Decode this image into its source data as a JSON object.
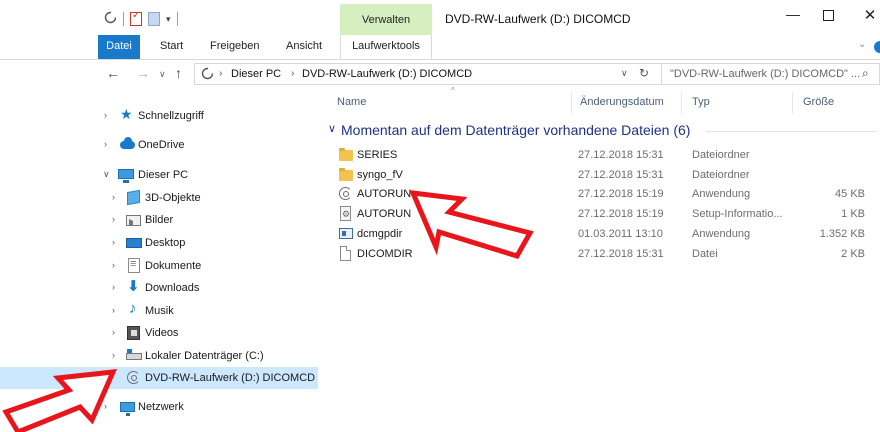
{
  "window": {
    "title": "DVD-RW-Laufwerk (D:) DICOMCD",
    "context_tab": "Verwalten",
    "controls": {
      "minimize": "—",
      "close": "✕"
    }
  },
  "ribbon": {
    "tabs": [
      "Datei",
      "Start",
      "Freigeben",
      "Ansicht",
      "Laufwerktools"
    ],
    "expand_glyph": "⌄"
  },
  "address": {
    "crumbs": [
      "Dieser PC",
      "DVD-RW-Laufwerk (D:) DICOMCD"
    ],
    "search_placeholder": "\"DVD-RW-Laufwerk (D:) DICOMCD\" ..."
  },
  "navigation": {
    "items": [
      {
        "label": "Schnellzugriff",
        "icon": "star-icon"
      },
      {
        "label": "OneDrive",
        "icon": "cloud-icon"
      },
      {
        "label": "Dieser PC",
        "icon": "computer-icon"
      },
      {
        "label": "3D-Objekte",
        "icon": "cube-icon"
      },
      {
        "label": "Bilder",
        "icon": "pictures-icon"
      },
      {
        "label": "Desktop",
        "icon": "desktop-icon"
      },
      {
        "label": "Dokumente",
        "icon": "documents-icon"
      },
      {
        "label": "Downloads",
        "icon": "download-icon"
      },
      {
        "label": "Musik",
        "icon": "music-icon"
      },
      {
        "label": "Videos",
        "icon": "video-icon"
      },
      {
        "label": "Lokaler Datenträger (C:)",
        "icon": "hard-drive-icon"
      },
      {
        "label": "DVD-RW-Laufwerk (D:) DICOMCD",
        "icon": "dvd-drive-icon",
        "selected": true
      },
      {
        "label": "Netzwerk",
        "icon": "network-icon"
      }
    ]
  },
  "columns": {
    "name": "Name",
    "date": "Änderungsdatum",
    "type": "Typ",
    "size": "Größe"
  },
  "group": {
    "label": "Momentan auf dem Datenträger vorhandene Dateien (6)"
  },
  "files": [
    {
      "name": "SERIES",
      "date": "27.12.2018 15:31",
      "type": "Dateiordner",
      "size": "",
      "icon": "folder-icon"
    },
    {
      "name": "syngo_fV",
      "date": "27.12.2018 15:31",
      "type": "Dateiordner",
      "size": "",
      "icon": "folder-icon"
    },
    {
      "name": "AUTORUN",
      "date": "27.12.2018 15:19",
      "type": "Anwendung",
      "size": "45 KB",
      "icon": "autorun-disc-icon"
    },
    {
      "name": "AUTORUN",
      "date": "27.12.2018 15:19",
      "type": "Setup-Informatio...",
      "size": "1 KB",
      "icon": "setup-file-icon"
    },
    {
      "name": "dcmgpdir",
      "date": "01.03.2011 13:10",
      "type": "Anwendung",
      "size": "1.352 KB",
      "icon": "application-icon"
    },
    {
      "name": "DICOMDIR",
      "date": "27.12.2018 15:31",
      "type": "Datei",
      "size": "2 KB",
      "icon": "file-icon"
    }
  ],
  "colors": {
    "accent": "#1979ca",
    "selection": "#cce8ff",
    "context_tab": "#d6efc0",
    "group_heading": "#1e3287",
    "annotation_arrow": "#e8161b"
  }
}
